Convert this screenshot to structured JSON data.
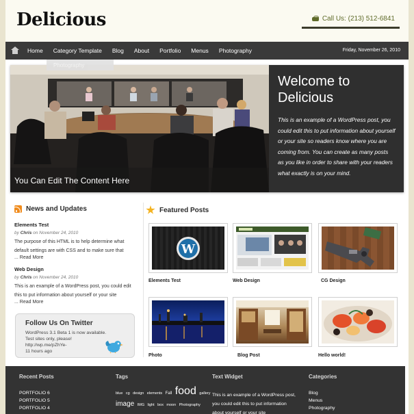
{
  "header": {
    "logo": "Delicious",
    "call": "Call Us: (213) 512-6841"
  },
  "nav": {
    "items": [
      "Home",
      "Category Template",
      "Blog",
      "About",
      "Portfolio",
      "Menus",
      "Photography"
    ],
    "date": "Friday, November 26, 2010",
    "dropdown_item": "Photography"
  },
  "hero": {
    "caption": "You Can Edit The Content Here",
    "title": "Welcome to Delicious",
    "body": "This is an example of a WordPress post, you could edit this to put information about yourself or your site so readers know where you are coming from. You can create as many posts as you like in order to share with your readers what exactly is on your mind."
  },
  "news": {
    "title": "News and Updates",
    "posts": [
      {
        "title": "Elements Test",
        "by": "by",
        "author": "Chris",
        "on": "on",
        "date": "November 24, 2010",
        "excerpt": "The purpose of this HTML is to help determine what default settings are with CSS and to make sure that",
        "more": "... Read More"
      },
      {
        "title": "Web Design",
        "by": "by",
        "author": "Chris",
        "on": "on",
        "date": "November 24, 2010",
        "excerpt": "This is an example of a WordPress post, you could edit this to put information about yourself or your site",
        "more": "... Read More"
      }
    ]
  },
  "twitter": {
    "title": "Follow Us On Twitter",
    "text": "WordPress 3.1 Beta 1 is now available. Test sites only, please! http://wp.me/pZhYe-",
    "time": "11 hours ago"
  },
  "featured": {
    "title": "Featured Posts",
    "items": [
      "Elements Test",
      "Web Design",
      "CG Design",
      "Photo",
      "Blog Post",
      "Hello world!"
    ]
  },
  "footer": {
    "recent": {
      "title": "Recent Posts",
      "items": [
        "PORTFOLIO 6",
        "PORTFOLIO 5",
        "PORTFOLIO 4"
      ]
    },
    "tags": {
      "title": "Tags",
      "line1": [
        "blue",
        "cg",
        "design",
        "elements",
        "Fall"
      ],
      "big": "food",
      "line1_end": "gallery",
      "line2_big": "image",
      "line2": [
        "IMG",
        "light",
        "box",
        "moon",
        "Photography"
      ]
    },
    "widget": {
      "title": "Text Widget",
      "text": "This is an example of a WordPress post, you could edit this to put information about yourself or your site"
    },
    "categories": {
      "title": "Categories",
      "items": [
        "Blog",
        "Menus",
        "Photography"
      ]
    }
  }
}
